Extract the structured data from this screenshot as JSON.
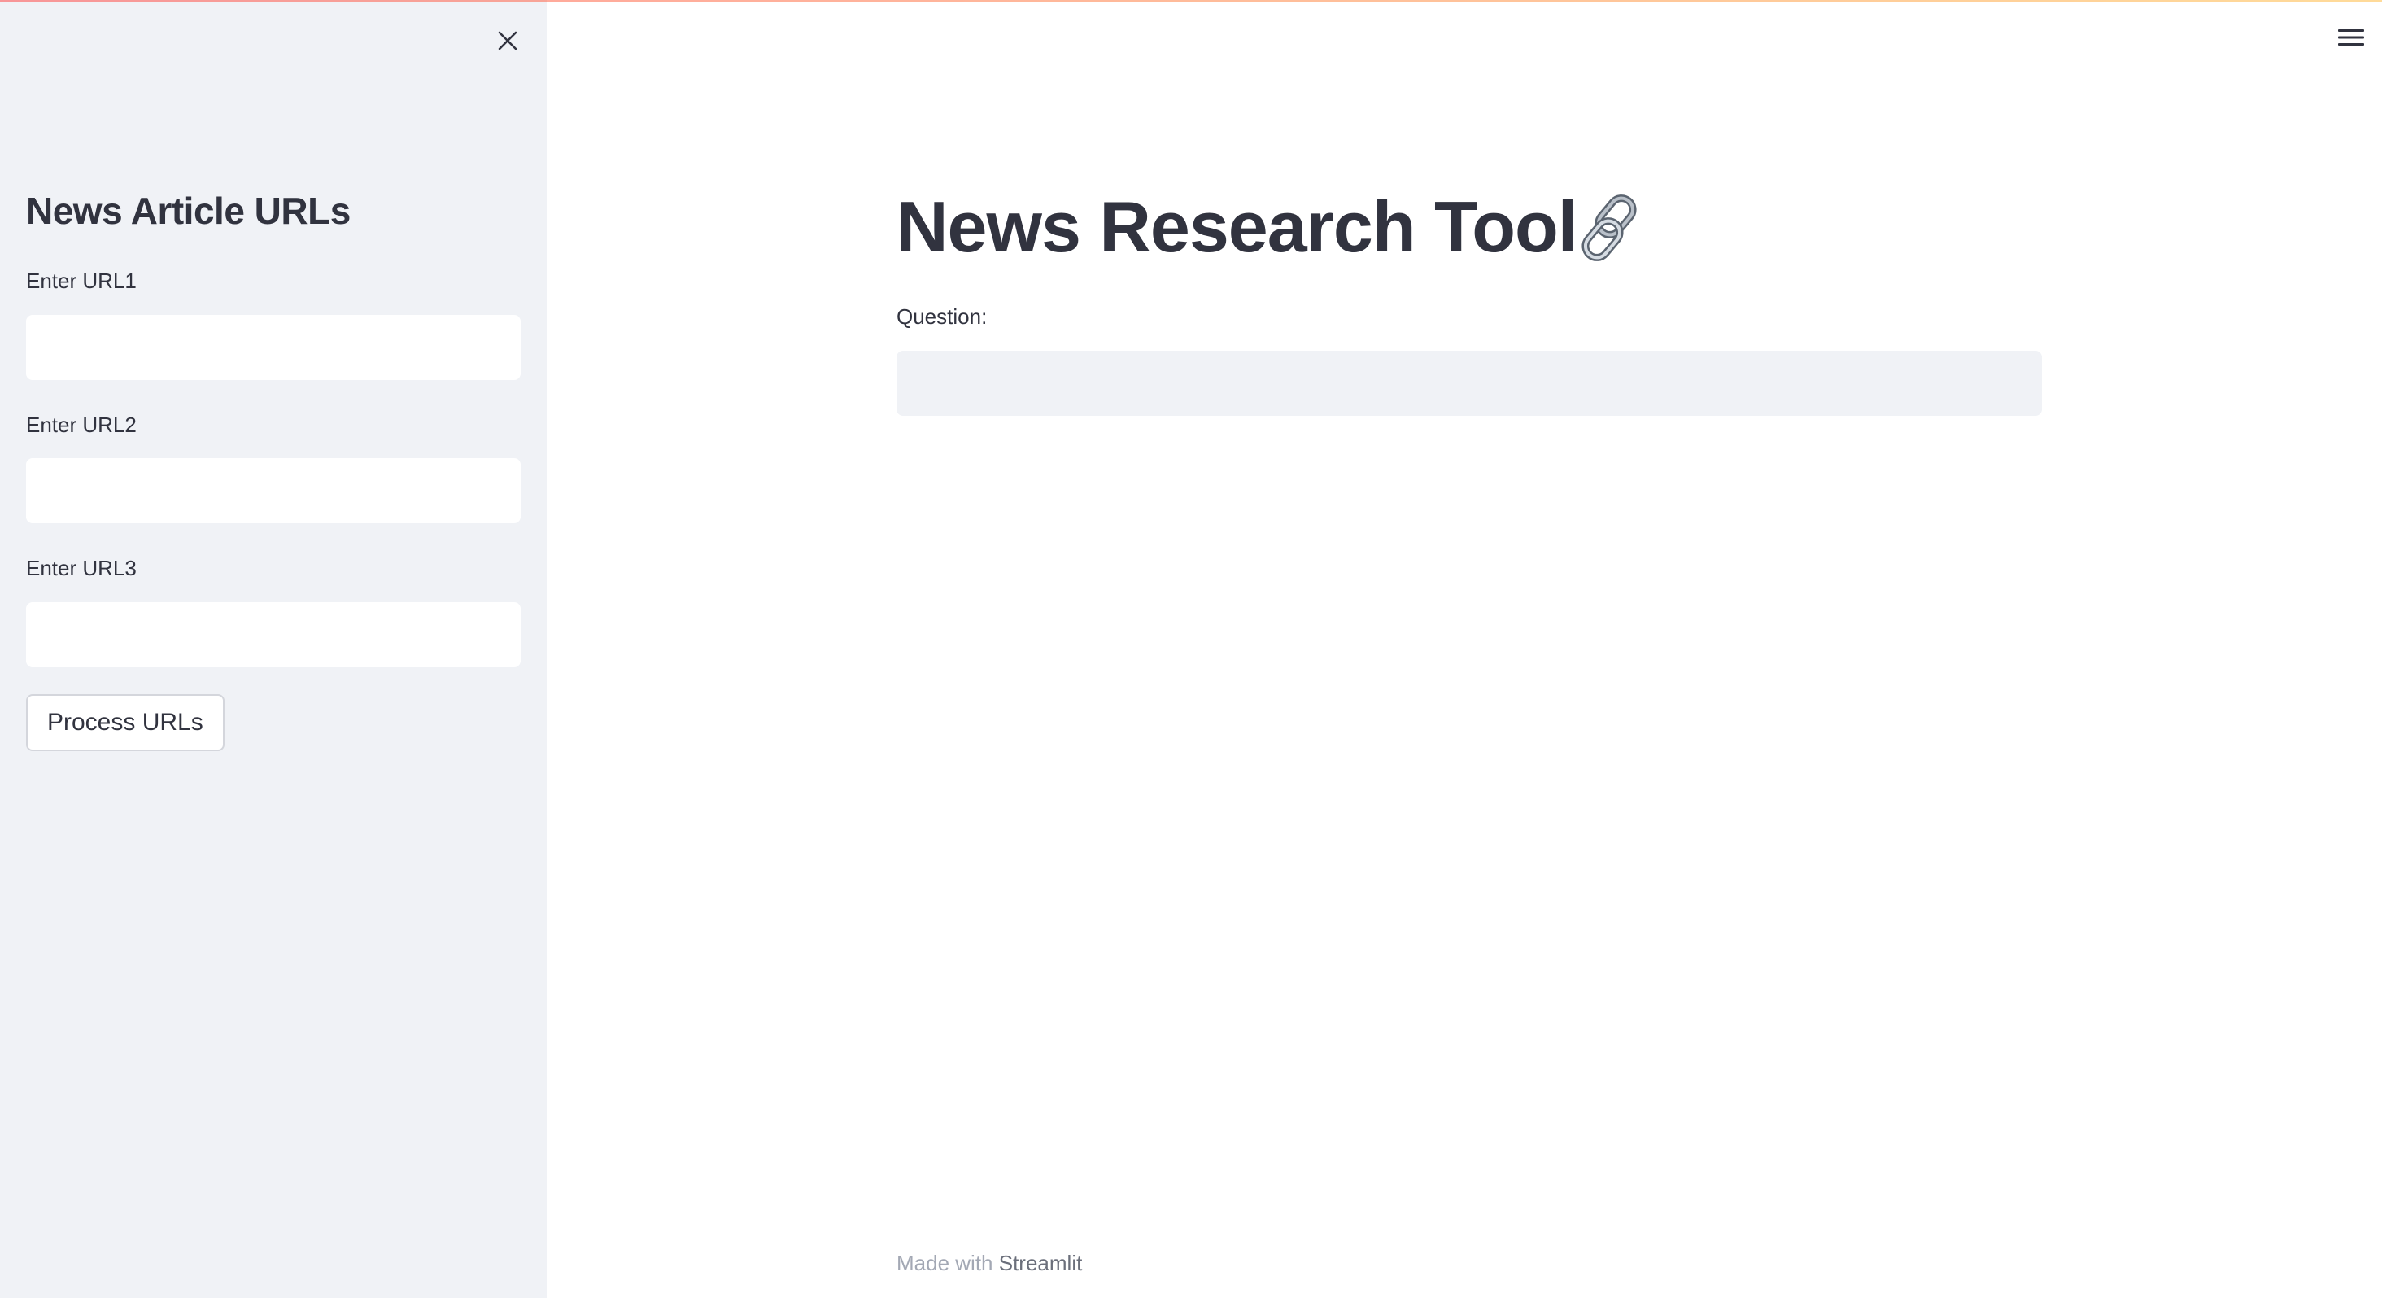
{
  "app": {
    "accent_gradient": [
      "#ff4b4b",
      "#ffbd45"
    ]
  },
  "sidebar": {
    "close_icon": "close-icon",
    "title": "News Article URLs",
    "fields": [
      {
        "label": "Enter URL1",
        "value": ""
      },
      {
        "label": "Enter URL2",
        "value": ""
      },
      {
        "label": "Enter URL3",
        "value": ""
      }
    ],
    "process_button_label": "Process URLs",
    "background": "#f0f2f6"
  },
  "header": {
    "menu_icon": "hamburger-menu-icon"
  },
  "main": {
    "title": "News Research Tool",
    "title_icon": "chain-link-icon",
    "question_label": "Question:",
    "question_value": ""
  },
  "footer": {
    "prefix": "Made with",
    "link_text": "Streamlit"
  }
}
